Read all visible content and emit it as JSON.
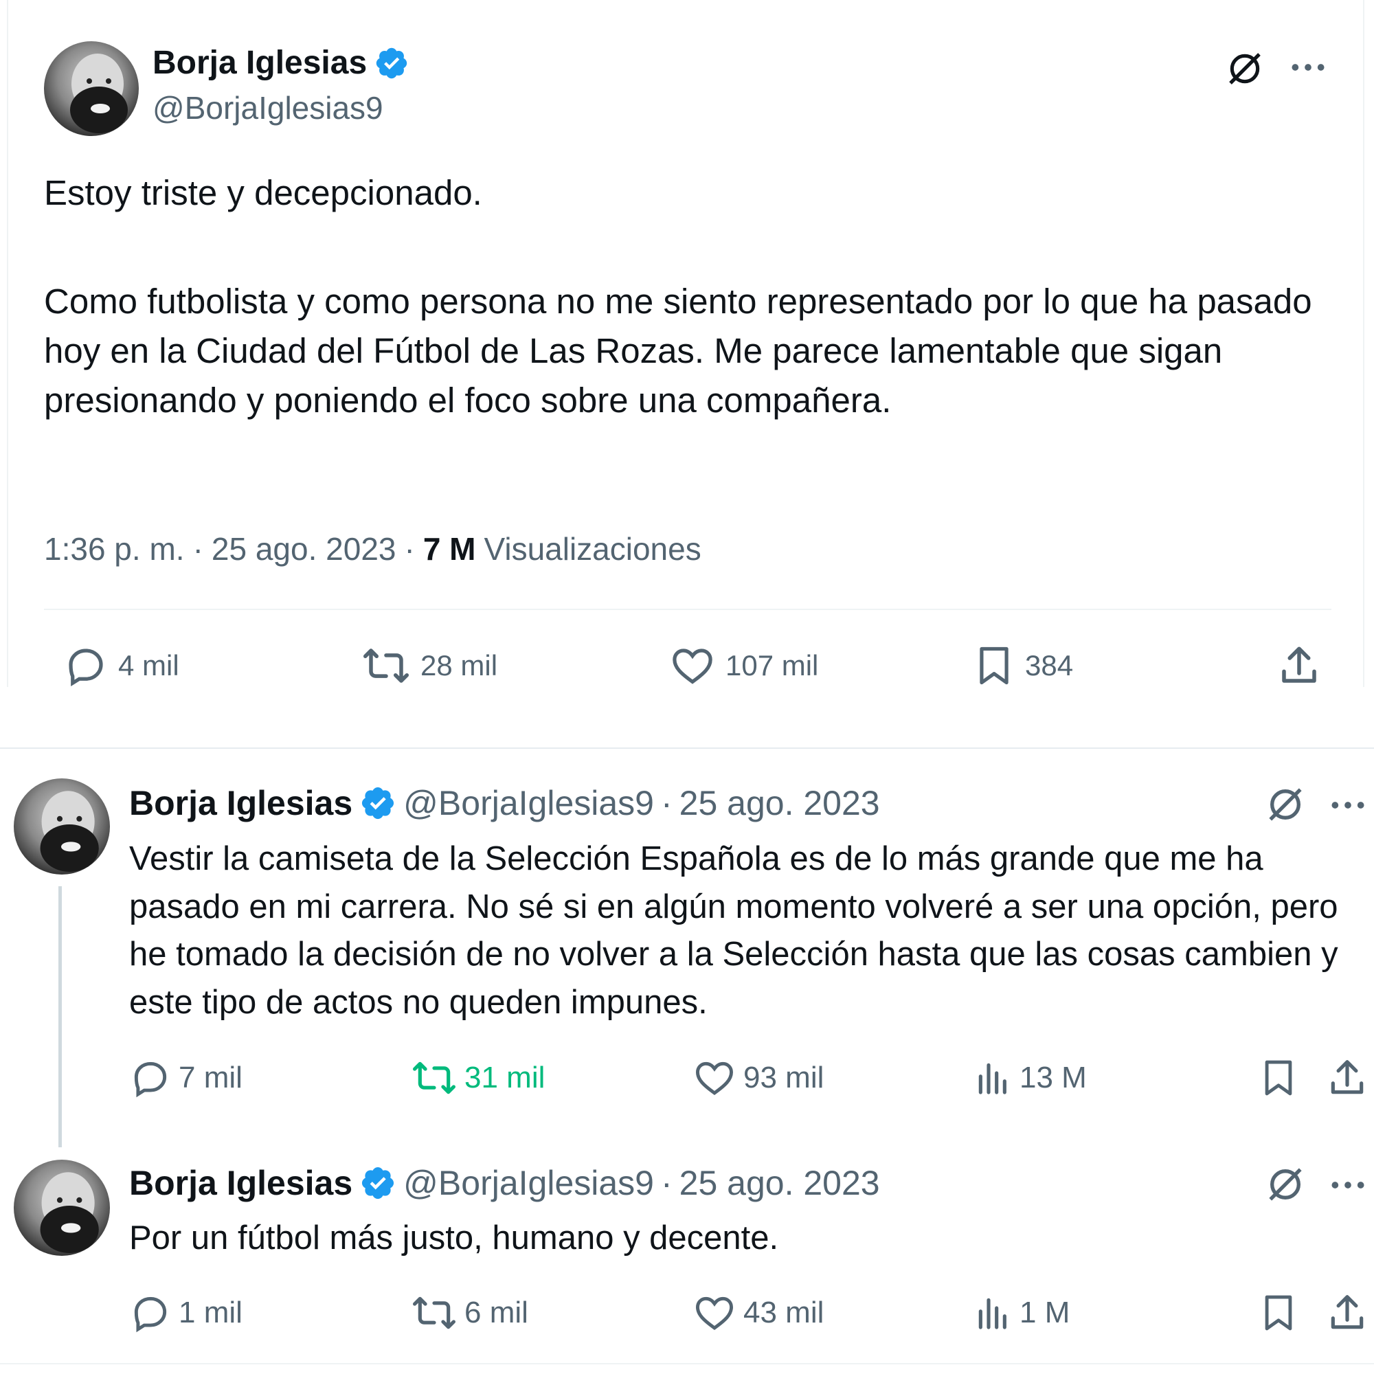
{
  "colors": {
    "text": "#0f1419",
    "muted": "#536471",
    "verified": "#1d9bf0",
    "retweet_active": "#00ba7c",
    "divider": "#eff3f4"
  },
  "main_tweet": {
    "author_name": "Borja Iglesias",
    "author_handle": "@BorjaIglesias9",
    "paragraphs": [
      "Estoy triste y decepcionado.",
      "Como futbolista y como persona no me siento representado por lo que ha pasado hoy en la Ciudad del Fútbol de Las Rozas. Me parece lamentable que sigan presionando y poniendo el foco sobre una compañera."
    ],
    "time": "1:36 p. m.",
    "date": "25 ago. 2023",
    "views_count": "7 M",
    "views_label": "Visualizaciones",
    "stats": {
      "replies": "4 mil",
      "retweets": "28 mil",
      "likes": "107 mil",
      "bookmarks": "384"
    },
    "icons": [
      "grok-icon",
      "more-icon",
      "reply-icon",
      "retweet-icon",
      "like-icon",
      "bookmark-icon",
      "share-icon"
    ]
  },
  "thread": [
    {
      "author_name": "Borja Iglesias",
      "author_handle": "@BorjaIglesias9",
      "date": "25 ago. 2023",
      "text": "Vestir la camiseta de la Selección Española es de lo más grande que me ha pasado en mi carrera. No sé si en algún momento volveré a ser una opción, pero he tomado la decisión de no volver a la Selección hasta que las cosas cambien y este tipo de actos no queden impunes.",
      "stats": {
        "replies": "7 mil",
        "retweets": "31 mil",
        "likes": "93 mil",
        "views": "13 M"
      },
      "retweeted": true
    },
    {
      "author_name": "Borja Iglesias",
      "author_handle": "@BorjaIglesias9",
      "date": "25 ago. 2023",
      "text": "Por un fútbol más justo, humano y decente.",
      "stats": {
        "replies": "1 mil",
        "retweets": "6 mil",
        "likes": "43 mil",
        "views": "1 M"
      },
      "retweeted": false
    }
  ]
}
